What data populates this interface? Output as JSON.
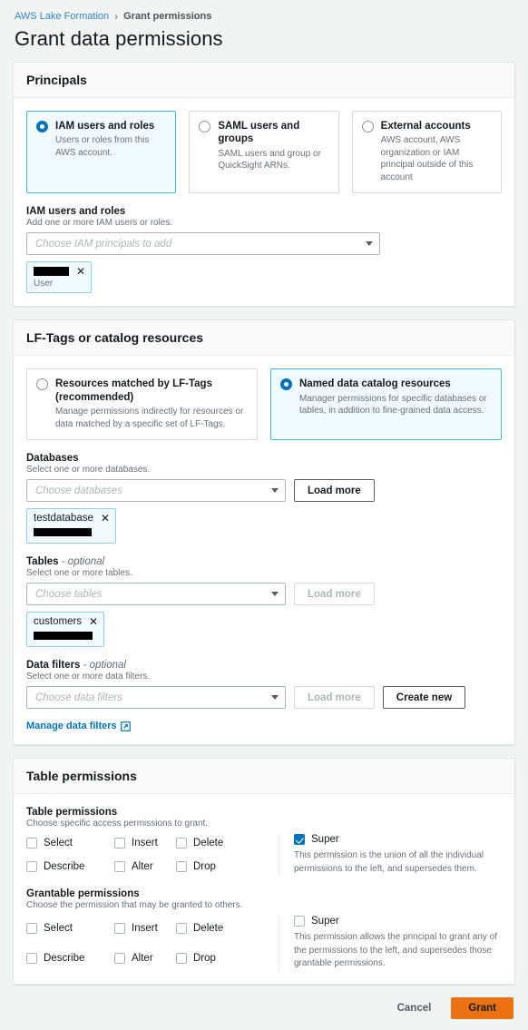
{
  "breadcrumb": {
    "root": "AWS Lake Formation",
    "separator": "›",
    "current": "Grant permissions"
  },
  "page": {
    "title": "Grant data permissions"
  },
  "principals": {
    "section_title": "Principals",
    "options": [
      {
        "title": "IAM users and roles",
        "description": "Users or roles from this AWS account.",
        "selected": true
      },
      {
        "title": "SAML users and groups",
        "description": "SAML users and group or QuickSight ARNs.",
        "selected": false
      },
      {
        "title": "External accounts",
        "description": "AWS account, AWS organization or IAM principal outside of this account",
        "selected": false
      }
    ],
    "field_label": "IAM users and roles",
    "field_desc": "Add one or more IAM users or roles.",
    "select_placeholder": "Choose IAM principals to add",
    "token": {
      "name_redacted": true,
      "sub_label": "User",
      "close": "✕"
    }
  },
  "resources": {
    "section_title": "LF-Tags or catalog resources",
    "options": [
      {
        "title": "Resources matched by LF-Tags (recommended)",
        "description": "Manage permissions indirectly for resources or data matched by a specific set of LF-Tags.",
        "selected": false
      },
      {
        "title": "Named data catalog resources",
        "description": "Manager permissions for specific databases or tables, in addition to fine-grained data access.",
        "selected": true
      }
    ],
    "databases": {
      "label": "Databases",
      "desc": "Select one or more databases.",
      "placeholder": "Choose databases",
      "load_more": "Load more",
      "load_more_enabled": true,
      "token_label": "testdatabase",
      "token_close": "✕"
    },
    "tables": {
      "label": "Tables",
      "optional": "- optional",
      "desc": "Select one or more tables.",
      "placeholder": "Choose tables",
      "load_more": "Load more",
      "load_more_enabled": false,
      "token_label": "customers",
      "token_close": "✕"
    },
    "data_filters": {
      "label": "Data filters",
      "optional": "- optional",
      "desc": "Select one or more data filters.",
      "placeholder": "Choose data filters",
      "load_more": "Load more",
      "load_more_enabled": false,
      "create_new": "Create new",
      "manage_link": "Manage data filters"
    }
  },
  "table_permissions": {
    "section_title": "Table permissions",
    "groups": [
      {
        "title": "Table permissions",
        "desc": "Choose specific access permissions to grant.",
        "checkboxes": [
          {
            "label": "Select",
            "checked": false
          },
          {
            "label": "Insert",
            "checked": false
          },
          {
            "label": "Delete",
            "checked": false
          },
          {
            "label": "Describe",
            "checked": false
          },
          {
            "label": "Alter",
            "checked": false
          },
          {
            "label": "Drop",
            "checked": false
          }
        ],
        "super": {
          "label": "Super",
          "checked": true,
          "note": "This permission is the union of all the individual permissions to the left, and supersedes them."
        }
      },
      {
        "title": "Grantable permissions",
        "desc": "Choose the permission that may be granted to others.",
        "checkboxes": [
          {
            "label": "Select",
            "checked": false
          },
          {
            "label": "Insert",
            "checked": false
          },
          {
            "label": "Delete",
            "checked": false
          },
          {
            "label": "Describe",
            "checked": false
          },
          {
            "label": "Alter",
            "checked": false
          },
          {
            "label": "Drop",
            "checked": false
          }
        ],
        "super": {
          "label": "Super",
          "checked": false,
          "note": "This permission allows the principal to grant any of the permissions to the left, and supersedes those grantable permissions."
        }
      }
    ]
  },
  "footer": {
    "cancel": "Cancel",
    "grant": "Grant"
  },
  "colors": {
    "accent_blue": "#0073bb",
    "link_blue": "#3184c2",
    "grant_orange": "#ec7211",
    "page_bg": "#f2f3f3",
    "selected_card_bg": "#f1faff",
    "selected_card_border": "#44b9d6"
  }
}
